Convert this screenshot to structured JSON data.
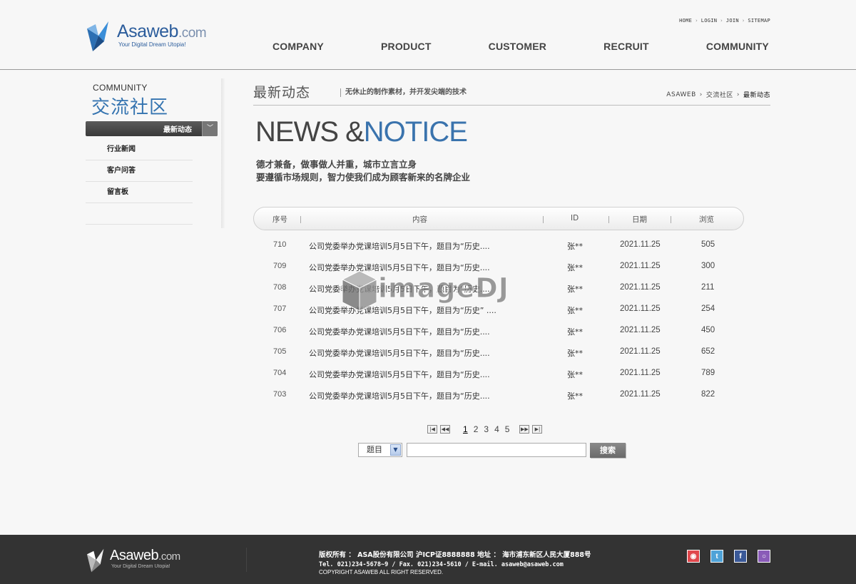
{
  "brand": {
    "name": "Asaweb",
    "domain": ".com",
    "tagline": "Your Digital Dream Utopia!",
    "colors": {
      "accent": "#3574b0",
      "footer_bg": "#333333",
      "button": "#777777"
    }
  },
  "util_nav": [
    "HOME",
    "LOGIN",
    "JOIN",
    "SITEMAP"
  ],
  "main_nav": [
    "COMPANY",
    "PRODUCT",
    "CUSTOMER",
    "RECRUIT",
    "COMMUNITY"
  ],
  "sidebar": {
    "title_en": "COMMUNITY",
    "title_cn": "交流社区",
    "active": "最新动态",
    "items": [
      "行业新闻",
      "客户问答",
      "留言板"
    ]
  },
  "content_header": {
    "title": "最新动态",
    "subtitle": "无休止的制作素材，并开发尖端的技术",
    "breadcrumb": [
      "ASAWEB",
      "交流社区",
      "最新动态"
    ]
  },
  "hero": {
    "title_part1": "NEWS &",
    "title_part2": "NOTICE",
    "line1": "德才兼备，做事做人并重，城市立言立身",
    "line2": "要遵循市场规则，智力使我们成为顾客新来的名牌企业"
  },
  "table": {
    "columns": [
      "序号",
      "内容",
      "ID",
      "日期",
      "浏览"
    ],
    "rows": [
      {
        "no": "710",
        "content": "公司党委举办党课培训5月5日下午，题目为“历史....",
        "id": "张**",
        "date": "2021.11.25",
        "views": "505"
      },
      {
        "no": "709",
        "content": "公司党委举办党课培训5月5日下午，题目为“历史....",
        "id": "张**",
        "date": "2021.11.25",
        "views": "300"
      },
      {
        "no": "708",
        "content": "公司党委举办党课培训5月5日下午，题目为“历史....",
        "id": "张**",
        "date": "2021.11.25",
        "views": "211"
      },
      {
        "no": "707",
        "content": "公司党委举办党课培训5月5日下午，题目为“历史” ....",
        "id": "张**",
        "date": "2021.11.25",
        "views": "254"
      },
      {
        "no": "706",
        "content": "公司党委举办党课培训5月5日下午，题目为“历史....",
        "id": "张**",
        "date": "2021.11.25",
        "views": "450"
      },
      {
        "no": "705",
        "content": "公司党委举办党课培训5月5日下午，题目为“历史....",
        "id": "张**",
        "date": "2021.11.25",
        "views": "652"
      },
      {
        "no": "704",
        "content": "公司党委举办党课培训5月5日下午，题目为“历史....",
        "id": "张**",
        "date": "2021.11.25",
        "views": "789"
      },
      {
        "no": "703",
        "content": "公司党委举办党课培训5月5日下午，题目为“历史....",
        "id": "张**",
        "date": "2021.11.25",
        "views": "822"
      }
    ]
  },
  "watermark": "imageDJ",
  "pagination": {
    "pages": [
      "1",
      "2",
      "3",
      "4",
      "5"
    ],
    "current": "1",
    "first_icon": "first-page-icon",
    "prev_icon": "prev-page-icon",
    "next_icon": "next-page-icon",
    "last_icon": "last-page-icon"
  },
  "search": {
    "field_selected": "题目",
    "input_value": "",
    "button_label": "搜索"
  },
  "footer": {
    "line1": "版权所有 ： ASA股份有限公司 沪ICP证8888888    地址 ： 海市浦东新区人民大厦888号",
    "line2": "Tel. 021)234-5678~9  / Fax. 021)234-5610  / E-mail. asaweb@asaweb.com",
    "line3": "COPYRIGHT ASAWEB ALL RIGHT RESERVED.",
    "social": [
      {
        "name": "weibo-icon",
        "color": "#e0474c"
      },
      {
        "name": "twitter-icon",
        "color": "#4fa3d8"
      },
      {
        "name": "facebook-icon",
        "color": "#3a5998"
      },
      {
        "name": "chat-icon",
        "color": "#8a5bb8"
      }
    ]
  }
}
